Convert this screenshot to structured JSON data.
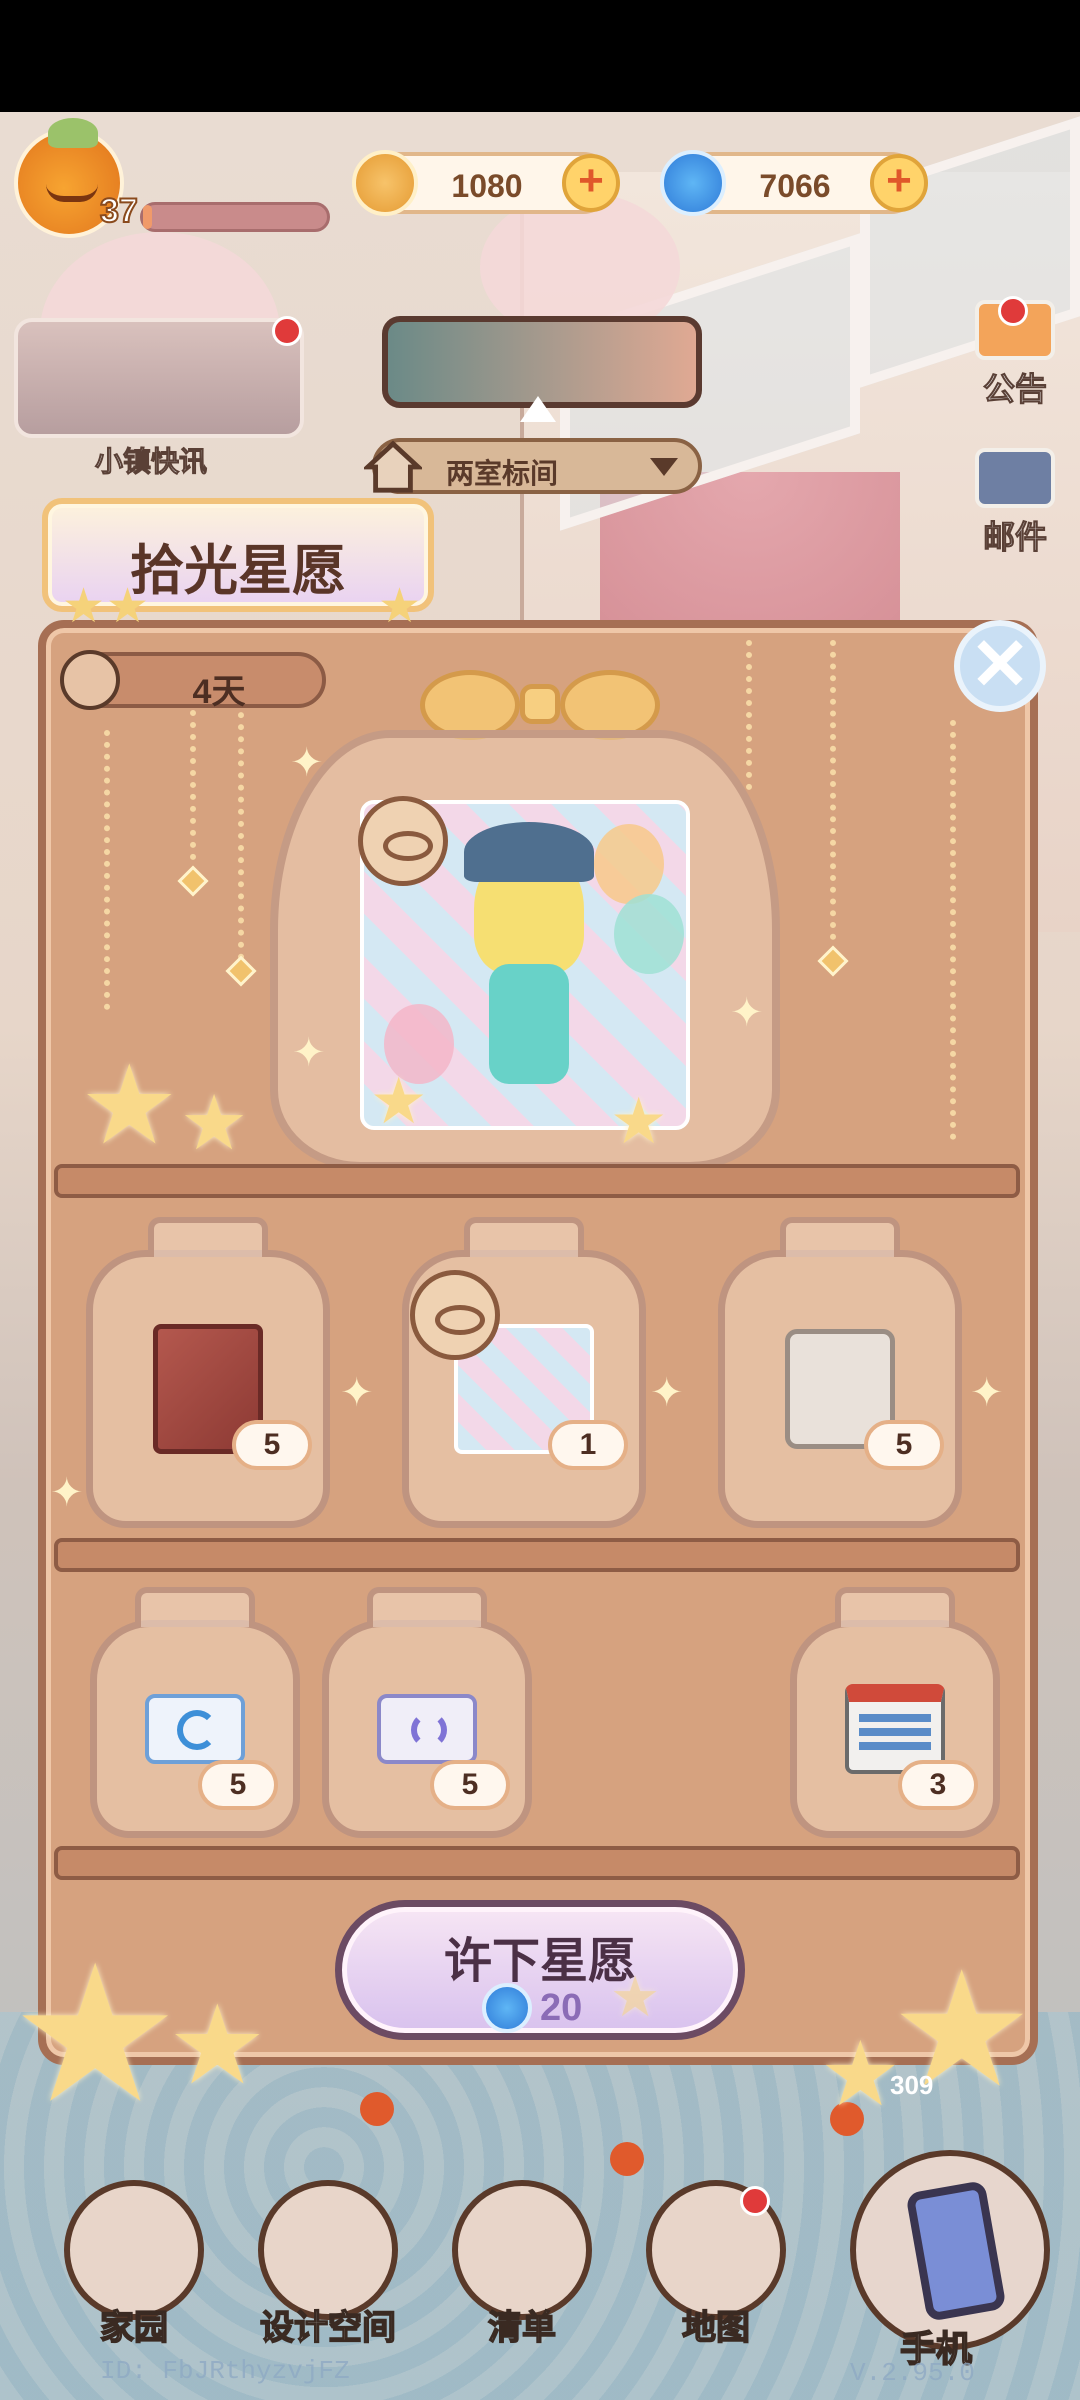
{
  "hud": {
    "level": "37",
    "xp_progress": 0.05,
    "coins": "1080",
    "gems": "7066"
  },
  "top_left": {
    "news_label": "小镇快讯"
  },
  "room": {
    "label": "两室标间"
  },
  "side": {
    "announcement": "公告",
    "mail": "邮件"
  },
  "event": {
    "title": "拾光星愿",
    "timer": "4天",
    "featured_reward": "outfit-card",
    "rewards": [
      {
        "icon": "book-icon",
        "count": "5"
      },
      {
        "icon": "card-icon",
        "count": "1"
      },
      {
        "icon": "scroll-icon",
        "count": "5"
      },
      {
        "icon": "ticket-icon",
        "count": "5"
      },
      {
        "icon": "refresh-ticket-icon",
        "count": "5"
      },
      {
        "icon": "calendar-icon",
        "count": "3"
      }
    ],
    "wish_button": {
      "label": "许下星愿",
      "cost": "20"
    }
  },
  "nav": {
    "home": "家园",
    "design": "设计空间",
    "list": "清单",
    "map": "地图",
    "phone": "手机"
  },
  "bubble_count": "309",
  "footer": {
    "id": "ID: FbJRthyzvjFZ",
    "version": "V.2.95.0"
  },
  "colors": {
    "panel": "#d6a27f",
    "accent": "#f1c27a",
    "alert": "#e03a3a"
  }
}
